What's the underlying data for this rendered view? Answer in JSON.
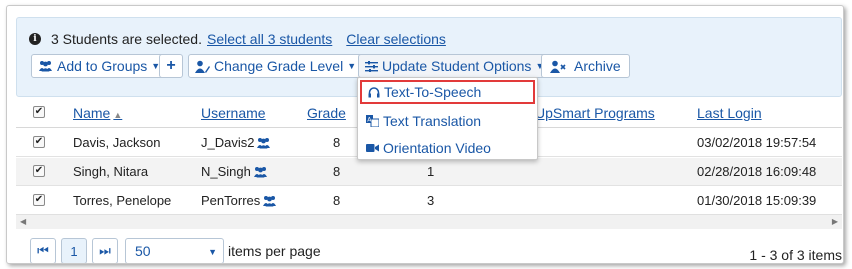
{
  "selection": {
    "message": "3 Students are selected.",
    "select_all": "Select all 3 students",
    "clear": "Clear selections"
  },
  "toolbar": {
    "add_to_groups": "Add to Groups",
    "change_grade_level": "Change Grade Level",
    "update_student_options": "Update Student Options",
    "archive": "Archive"
  },
  "dropdown": {
    "items": [
      "Text-To-Speech",
      "Text Translation",
      "Orientation Video"
    ]
  },
  "table": {
    "columns": [
      "Name",
      "Username",
      "Grade",
      "UpSmart Programs",
      "Last Login"
    ],
    "rows": [
      {
        "name": "Davis, Jackson",
        "username": "J_Davis2",
        "grade": "8",
        "programs": "",
        "last_login": "03/02/2018 19:57:54",
        "checked": true
      },
      {
        "name": "Singh, Nitara",
        "username": "N_Singh",
        "grade": "8",
        "programs": "1",
        "last_login": "02/28/2018 16:09:48",
        "checked": true
      },
      {
        "name": "Torres, Penelope",
        "username": "PenTorres",
        "grade": "8",
        "programs": "3",
        "last_login": "01/30/2018 15:09:39",
        "checked": true
      }
    ]
  },
  "pager": {
    "current_page": "1",
    "per_page": "50",
    "per_page_label": "items per page",
    "summary": "1 - 3 of 3 items"
  },
  "colors": {
    "link": "#1a57a6",
    "panel": "#e8f2fb",
    "highlight": "#e23a3a"
  }
}
